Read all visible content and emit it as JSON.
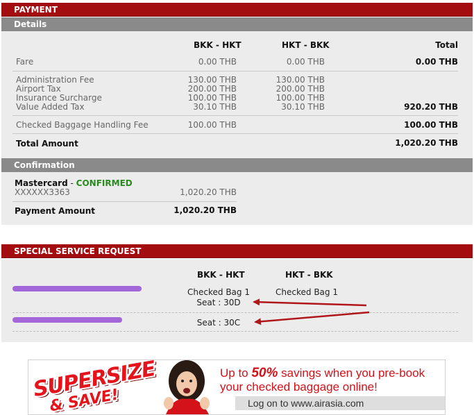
{
  "payment": {
    "title": "PAYMENT",
    "details_title": "Details",
    "columns": {
      "leg1": "BKK - HKT",
      "leg2": "HKT - BKK",
      "total": "Total"
    },
    "rows": {
      "fare": {
        "label": "Fare",
        "leg1": "0.00 THB",
        "leg2": "0.00 THB",
        "total": "0.00 THB"
      },
      "admin_fee": {
        "label": "Administration Fee",
        "leg1": "130.00 THB",
        "leg2": "130.00 THB"
      },
      "airport_tax": {
        "label": "Airport Tax",
        "leg1": "200.00 THB",
        "leg2": "200.00 THB"
      },
      "insurance": {
        "label": "Insurance Surcharge",
        "leg1": "100.00 THB",
        "leg2": "100.00 THB"
      },
      "vat": {
        "label": "Value Added Tax",
        "leg1": "30.10 THB",
        "leg2": "30.10 THB",
        "total": "920.20 THB"
      },
      "baggage": {
        "label": "Checked Baggage Handling Fee",
        "leg1": "100.00 THB",
        "total": "100.00 THB"
      }
    },
    "total_amount": {
      "label": "Total Amount",
      "value": "1,020.20 THB"
    },
    "confirmation_title": "Confirmation",
    "card": {
      "name": "Mastercard",
      "separator": " - ",
      "status": "CONFIRMED",
      "number": "XXXXXX3363",
      "amount": "1,020.20 THB"
    },
    "payment_amount": {
      "label": "Payment Amount",
      "value": "1,020.20 THB"
    }
  },
  "ssr": {
    "title": "SPECIAL SERVICE REQUEST",
    "columns": {
      "leg1": "BKK - HKT",
      "leg2": "HKT - BKK"
    },
    "passengers": [
      {
        "leg1_line1": "Checked Bag 1",
        "leg1_line2": "Seat : 30D",
        "leg2_line1": "Checked Bag 1"
      },
      {
        "leg1_line1": "Seat : 30C"
      }
    ]
  },
  "banner": {
    "logo_line1": "SUPERSIZE",
    "logo_line2": "& SAVE!",
    "headline_prefix": "Up to ",
    "headline_highlight": "50%",
    "headline_suffix": " savings when you pre-book",
    "headline_line2": "your checked baggage online!",
    "cta": "Log on to www.airasia.com"
  },
  "colors": {
    "brand_red": "#a30d10",
    "section_gray": "#8a8a8a",
    "panel_bg": "#ececec",
    "confirmed_green": "#2a8a1f",
    "annotation_arrow": "#b0161a"
  }
}
